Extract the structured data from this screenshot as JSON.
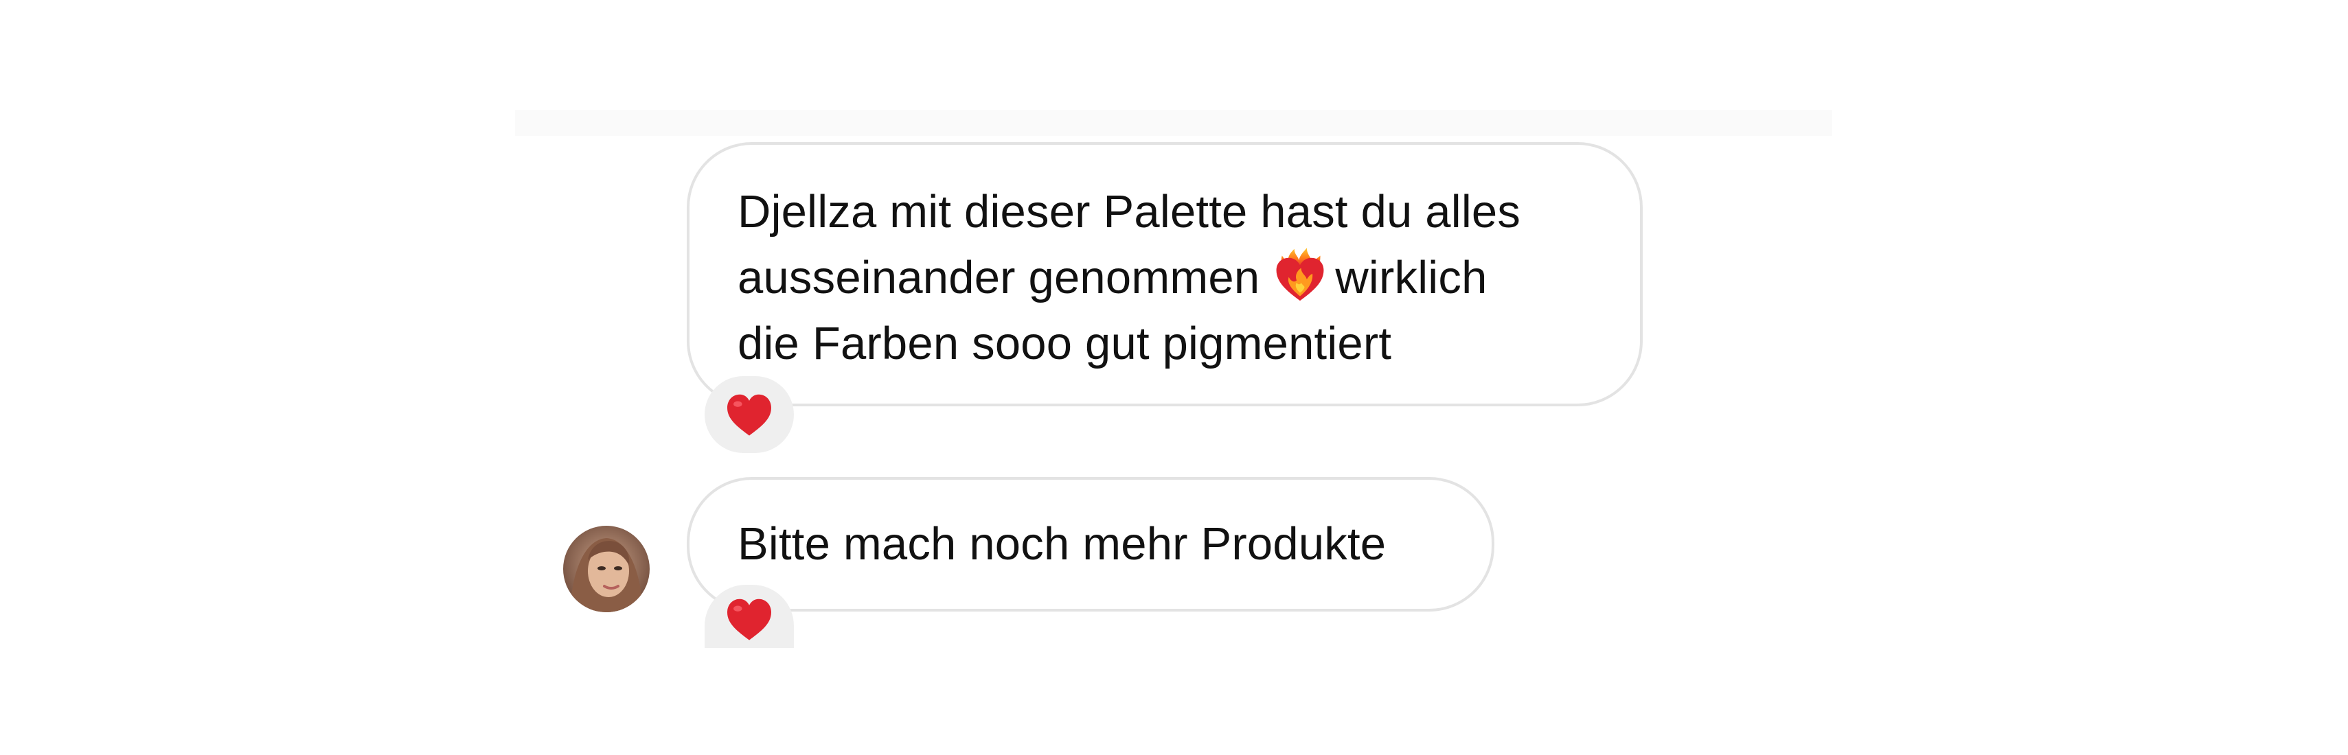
{
  "messages": [
    {
      "lines": [
        "Djellza mit dieser Palette hast du alles",
        "ausseinander genommen",
        "wirklich",
        "die Farben sooo gut pigmentiert"
      ],
      "inline_emoji": "heart-on-fire-icon",
      "reaction_icon": "red-heart-icon"
    },
    {
      "text": "Bitte mach noch mehr Produkte",
      "reaction_icon": "red-heart-icon",
      "avatar": "user-avatar"
    }
  ],
  "colors": {
    "bubble_border": "#e3e3e3",
    "reaction_bg": "#efefef",
    "heart": "#e0242f",
    "text": "#111111"
  }
}
